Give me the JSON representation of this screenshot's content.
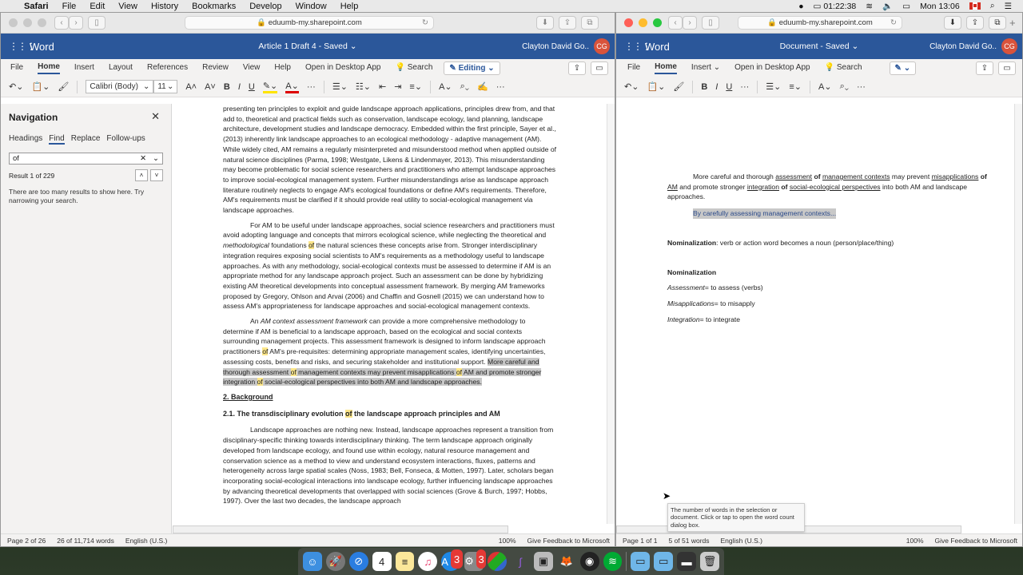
{
  "menubar": {
    "app": "Safari",
    "items": [
      "File",
      "Edit",
      "View",
      "History",
      "Bookmarks",
      "Develop",
      "Window",
      "Help"
    ],
    "recording_time": "01:22:38",
    "clock": "Mon 13:06"
  },
  "left_window": {
    "url": "eduumb-my.sharepoint.com",
    "app_name": "Word",
    "doc_title": "Article 1 Draft 4 - Saved ⌄",
    "user_name": "Clayton David Go..",
    "user_initials": "CG",
    "tabs": [
      "File",
      "Home",
      "Insert",
      "Layout",
      "References",
      "Review",
      "View",
      "Help",
      "Open in Desktop App"
    ],
    "active_tab": "Home",
    "search_label": "Search",
    "editing_label": "Editing ⌄",
    "font_name": "Calibri (Body)",
    "font_size": "11",
    "navigation": {
      "title": "Navigation",
      "tabs": [
        "Headings",
        "Find",
        "Replace",
        "Follow-ups"
      ],
      "active_tab": "Find",
      "search_value": "of",
      "result_text": "Result 1 of 229",
      "message": "There are too many results to show here. Try narrowing your search."
    },
    "document": {
      "p1": "presenting ten principles to exploit and guide landscape approach applications, principles drew from, and that add to, theoretical and practical fields such as conservation, landscape ecology, land planning, landscape architecture, development studies and landscape democracy. Embedded within the first principle, Sayer et al., (2013) inherently link landscape approaches to an ecological methodology - adaptive management (AM). While widely cited, AM remains a regularly misinterpreted and misunderstood method when applied outside of natural science disciplines (Parma, 1998; Westgate, Likens & Lindenmayer, 2013). This misunderstanding may become problematic for social science researchers and practitioners who attempt landscape approaches to improve social-ecological management system. Further misunderstandings arise as landscape approach literature routinely neglects to engage AM's ecological foundations or define AM's requirements. Therefore, AM's requirements must be clarified if it should provide real utility to social-ecological management via landscape approaches.",
      "p2a": "For AM to be useful under landscape approaches, social science researchers and practitioners must avoid adopting language and concepts that mirrors ecological science, while neglecting the theoretical and ",
      "p2_italic": "methodological",
      "p2b": " foundations ",
      "p2c": " the natural sciences these concepts arise from. Stronger interdisciplinary integration requires exposing social scientists to AM's requirements as a methodology useful to landscape approaches. As with any methodology, social-ecological contexts must be assessed to determine if AM is an appropriate method for any landscape approach project. Such an assessment can be done by hybridizing existing AM theoretical developments into conceptual assessment framework. By merging AM frameworks proposed by Gregory, Ohlson and Arvai (2006) and Chaffin and Gosnell (2015) we can understand how to assess AM's appropriateness for landscape approaches and social-ecological management contexts.",
      "p3a": "An ",
      "p3_italic": "AM context assessment framework",
      "p3b": " can provide a more comprehensive methodology to determine if AM is beneficial to a landscape approach, based on the ecological and social contexts surrounding management projects. This assessment framework is designed to inform landscape approach practitioners ",
      "p3c": " AM's pre-requisites: determining appropriate management scales, identifying uncertainties, assessing costs, benefits and risks, and securing stakeholder and institutional support. ",
      "p3_sel1": "More careful and thorough assessment ",
      "p3_sel2": " management contexts may prevent misapplications ",
      "p3_sel3": " AM and promote stronger integration ",
      "p3_sel4": " social-ecological perspectives into both AM and landscape approaches.",
      "of": "of",
      "h2": "2. Background",
      "h3a": "2.1. The transdisciplinary evolution ",
      "h3b": " the landscape approach principles and AM",
      "p4": "Landscape approaches are nothing new. Instead, landscape approaches represent a transition from disciplinary-specific thinking towards interdisciplinary thinking. The term landscape approach originally developed from landscape ecology, and found use within ecology, natural resource management and conservation science as a method to view and understand ecosystem interactions, fluxes, patterns and heterogeneity across large spatial scales (Noss, 1983; Bell, Fonseca, & Motten, 1997). Later, scholars began incorporating social-ecological interactions into landscape ecology, further influencing landscape approaches by advancing theoretical developments that overlapped with social sciences (Grove & Burch, 1997; Hobbs, 1997). Over the last two decades, the landscape approach"
    },
    "status": {
      "page": "Page 2 of 26",
      "words": "26 of 11,714 words",
      "language": "English (U.S.)",
      "zoom": "100%",
      "feedback": "Give Feedback to Microsoft"
    }
  },
  "right_window": {
    "url": "eduumb-my.sharepoint.com",
    "app_name": "Word",
    "doc_title": "Document - Saved ⌄",
    "user_name": "Clayton David Go..",
    "user_initials": "CG",
    "tabs": [
      "File",
      "Home",
      "Insert ⌄",
      "Open in Desktop App"
    ],
    "active_tab": "Home",
    "search_label": "Search",
    "document": {
      "s1": "More careful and thorough ",
      "u_assessment": "assessment",
      "of": "of",
      "u_management": "management contexts",
      "s2": " may prevent ",
      "u_misapp": "misapplications",
      "u_am": "AM",
      "s3": " and promote stronger ",
      "u_integration": "integration",
      "u_social": "social-ecological perspectives",
      "s4": " into both AM and landscape approaches.",
      "selected": "By carefully assessing management contexts...",
      "nom_label": "Nominalization",
      "nom_def": ": verb or action word becomes a noun (person/place/thing)",
      "nom_heading": "Nominalization",
      "examples": [
        {
          "term": "Assessment",
          "def": "= to assess (verbs)"
        },
        {
          "term": "Misapplications",
          "def": "= to misapply"
        },
        {
          "term": "Integration",
          "def": "= to integrate"
        }
      ]
    },
    "tooltip": "The number of words in the selection or document. Click or tap to open the word count dialog box.",
    "status": {
      "page": "Page 1 of 1",
      "words": "5 of 51 words",
      "language": "English (U.S.)",
      "zoom": "100%",
      "feedback": "Give Feedback to Microsoft"
    }
  },
  "dock": {
    "apps": [
      "Finder",
      "Launchpad",
      "Safari",
      "Calendar",
      "Notes",
      "Music",
      "App Store",
      "System Preferences",
      "Chrome-like",
      "Shortcuts",
      "Disk Utility",
      "GIMP",
      "OBS",
      "Audio"
    ],
    "calendar_day": "4",
    "app_store_badge": "3",
    "prefs_badge": "3"
  }
}
